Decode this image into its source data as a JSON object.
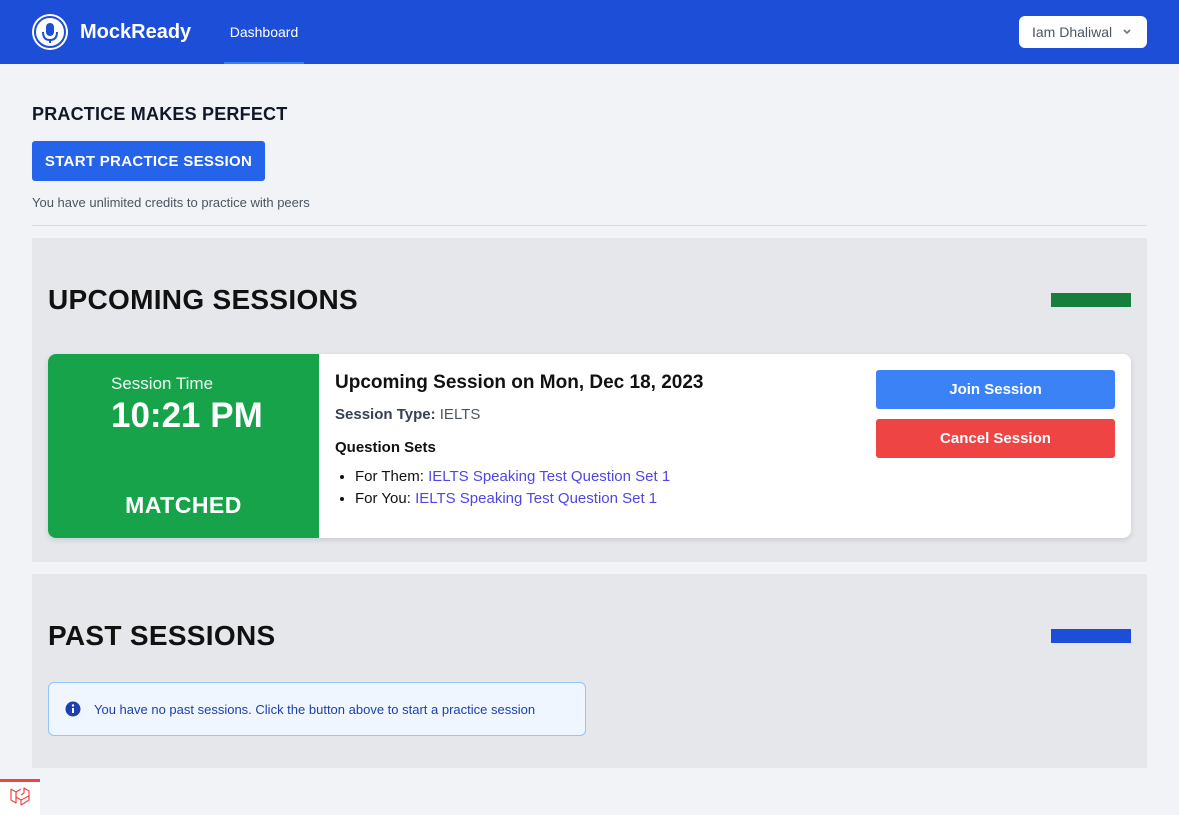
{
  "colors": {
    "nav_bg": "#1d4ed8",
    "primary": "#2563eb",
    "matched_green": "#16a34a",
    "upcoming_accent": "#15803d",
    "past_accent": "#1d4ed8",
    "join": "#3b82f6",
    "cancel": "#ef4444",
    "link": "#4f46e5"
  },
  "nav": {
    "brand": "MockReady",
    "logo_icon": "microphone-logo-icon",
    "links": [
      {
        "label": "Dashboard",
        "active": true
      }
    ],
    "user": "Iam Dhaliwal",
    "user_menu_icon": "chevron-down-icon"
  },
  "practice": {
    "title": "PRACTICE MAKES PERFECT",
    "button_label": "START PRACTICE SESSION",
    "credits_text": "You have unlimited credits to practice with peers"
  },
  "upcoming": {
    "title": "UPCOMING SESSIONS",
    "session": {
      "time_label": "Session Time",
      "time": "10:21 PM",
      "status": "MATCHED",
      "heading": "Upcoming Session on Mon, Dec 18, 2023",
      "type_label": "Session Type:",
      "type_value": "IELTS",
      "question_sets_label": "Question Sets",
      "question_sets": [
        {
          "label": "For Them:",
          "link": "IELTS Speaking Test Question Set 1"
        },
        {
          "label": "For You:",
          "link": "IELTS Speaking Test Question Set 1"
        }
      ],
      "join_label": "Join Session",
      "cancel_label": "Cancel Session"
    }
  },
  "past": {
    "title": "PAST SESSIONS",
    "empty_icon": "info-icon",
    "empty_message": "You have no past sessions. Click the button above to start a practice session"
  },
  "debug_icon": "laravel-icon"
}
